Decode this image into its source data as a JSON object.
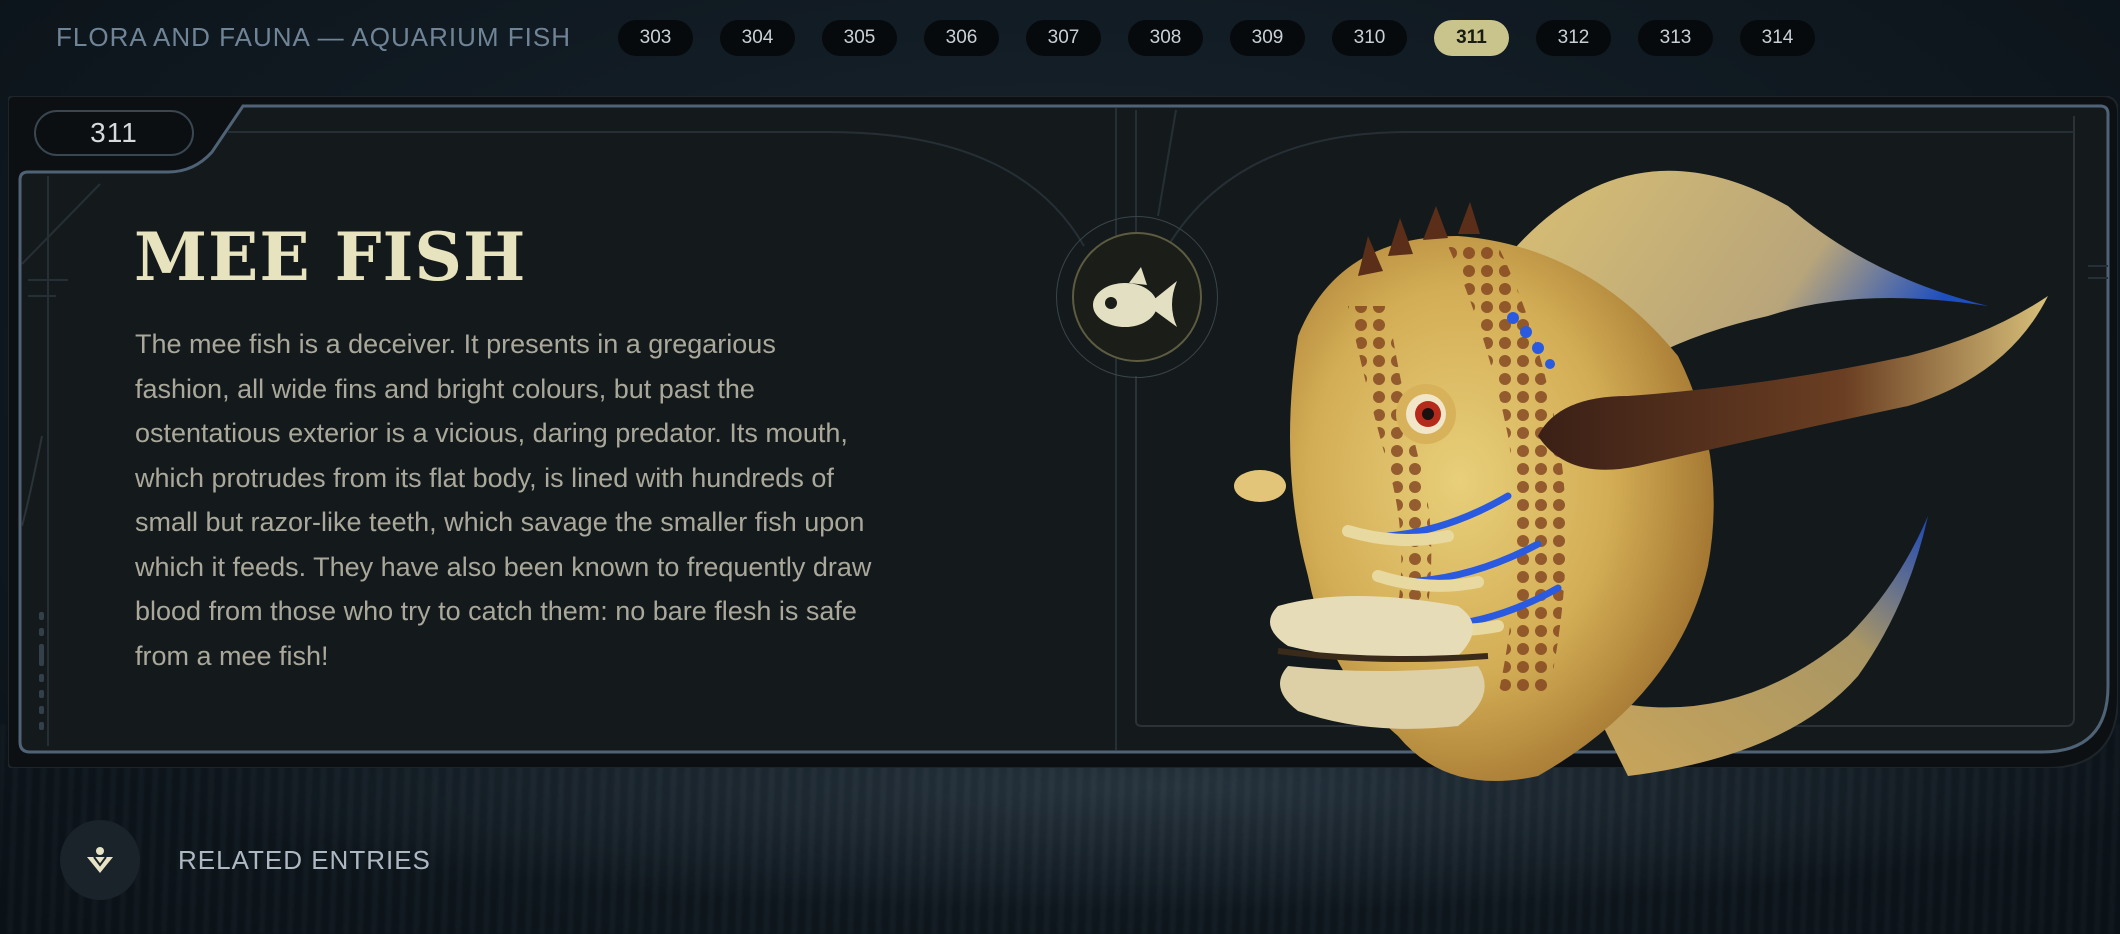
{
  "header": {
    "category_title": "FLORA AND FAUNA — AQUARIUM FISH",
    "entries": [
      {
        "label": "303",
        "active": false
      },
      {
        "label": "304",
        "active": false
      },
      {
        "label": "305",
        "active": false
      },
      {
        "label": "306",
        "active": false
      },
      {
        "label": "307",
        "active": false
      },
      {
        "label": "308",
        "active": false
      },
      {
        "label": "309",
        "active": false
      },
      {
        "label": "310",
        "active": false
      },
      {
        "label": "311",
        "active": true
      },
      {
        "label": "312",
        "active": false
      },
      {
        "label": "313",
        "active": false
      },
      {
        "label": "314",
        "active": false
      }
    ]
  },
  "entry": {
    "number": "311",
    "name": "MEE FISH",
    "description": "The mee fish is a deceiver. It presents in a gregarious fashion, all wide fins and bright colours, but past the ostentatious exterior is a vicious, daring predator. Its mouth, which protrudes from its flat body, is lined with hundreds of small but razor-like teeth, which savage the smaller fish upon which it feeds. They have also been known to frequently draw blood from those who try to catch them: no bare flesh is safe from a mee fish!",
    "emblem_icon": "fish-icon",
    "portrait": "mee-fish-portrait"
  },
  "footer": {
    "related_label": "RELATED ENTRIES",
    "related_icon": "related-entries-icon"
  },
  "colors": {
    "accent": "#c8c48c",
    "title": "#e7e3be",
    "body_text": "#a9a89a",
    "panel": "#141a1c"
  }
}
